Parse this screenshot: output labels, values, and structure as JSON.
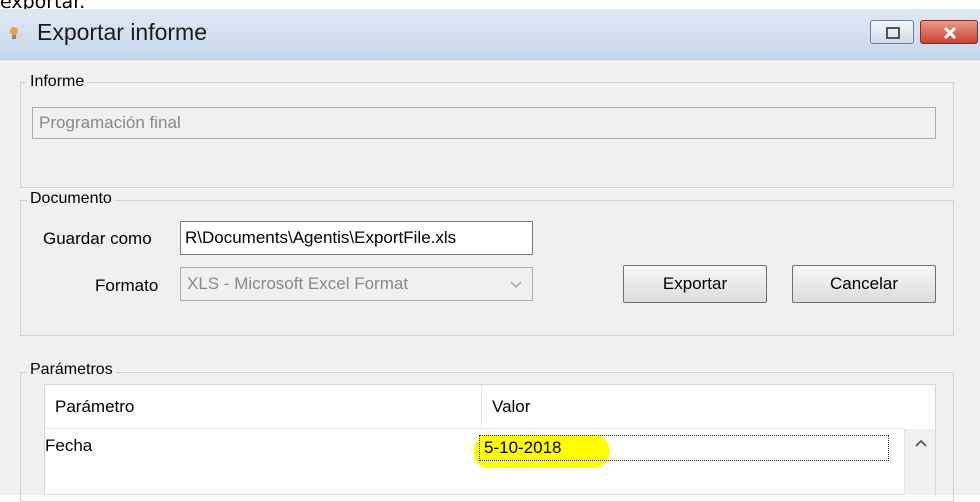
{
  "page_top_text": "exportar.",
  "window": {
    "title": "Exportar informe",
    "icon": "app-icon",
    "buttons": [
      "restore-icon",
      "close-icon"
    ]
  },
  "informe": {
    "legend": "Informe",
    "value": "Programación final"
  },
  "documento": {
    "legend": "Documento",
    "guardar_label": "Guardar como",
    "guardar_value": "R\\Documents\\Agentis\\ExportFile.xls",
    "formato_label": "Formato",
    "formato_value": "XLS - Microsoft Excel Format",
    "exportar_label": "Exportar",
    "cancelar_label": "Cancelar"
  },
  "parametros": {
    "legend": "Parámetros",
    "columns": [
      "Parámetro",
      "Valor"
    ],
    "rows": [
      {
        "parametro": "Fecha",
        "valor": "5-10-2018"
      }
    ],
    "highlight_color": "#ffff00"
  }
}
